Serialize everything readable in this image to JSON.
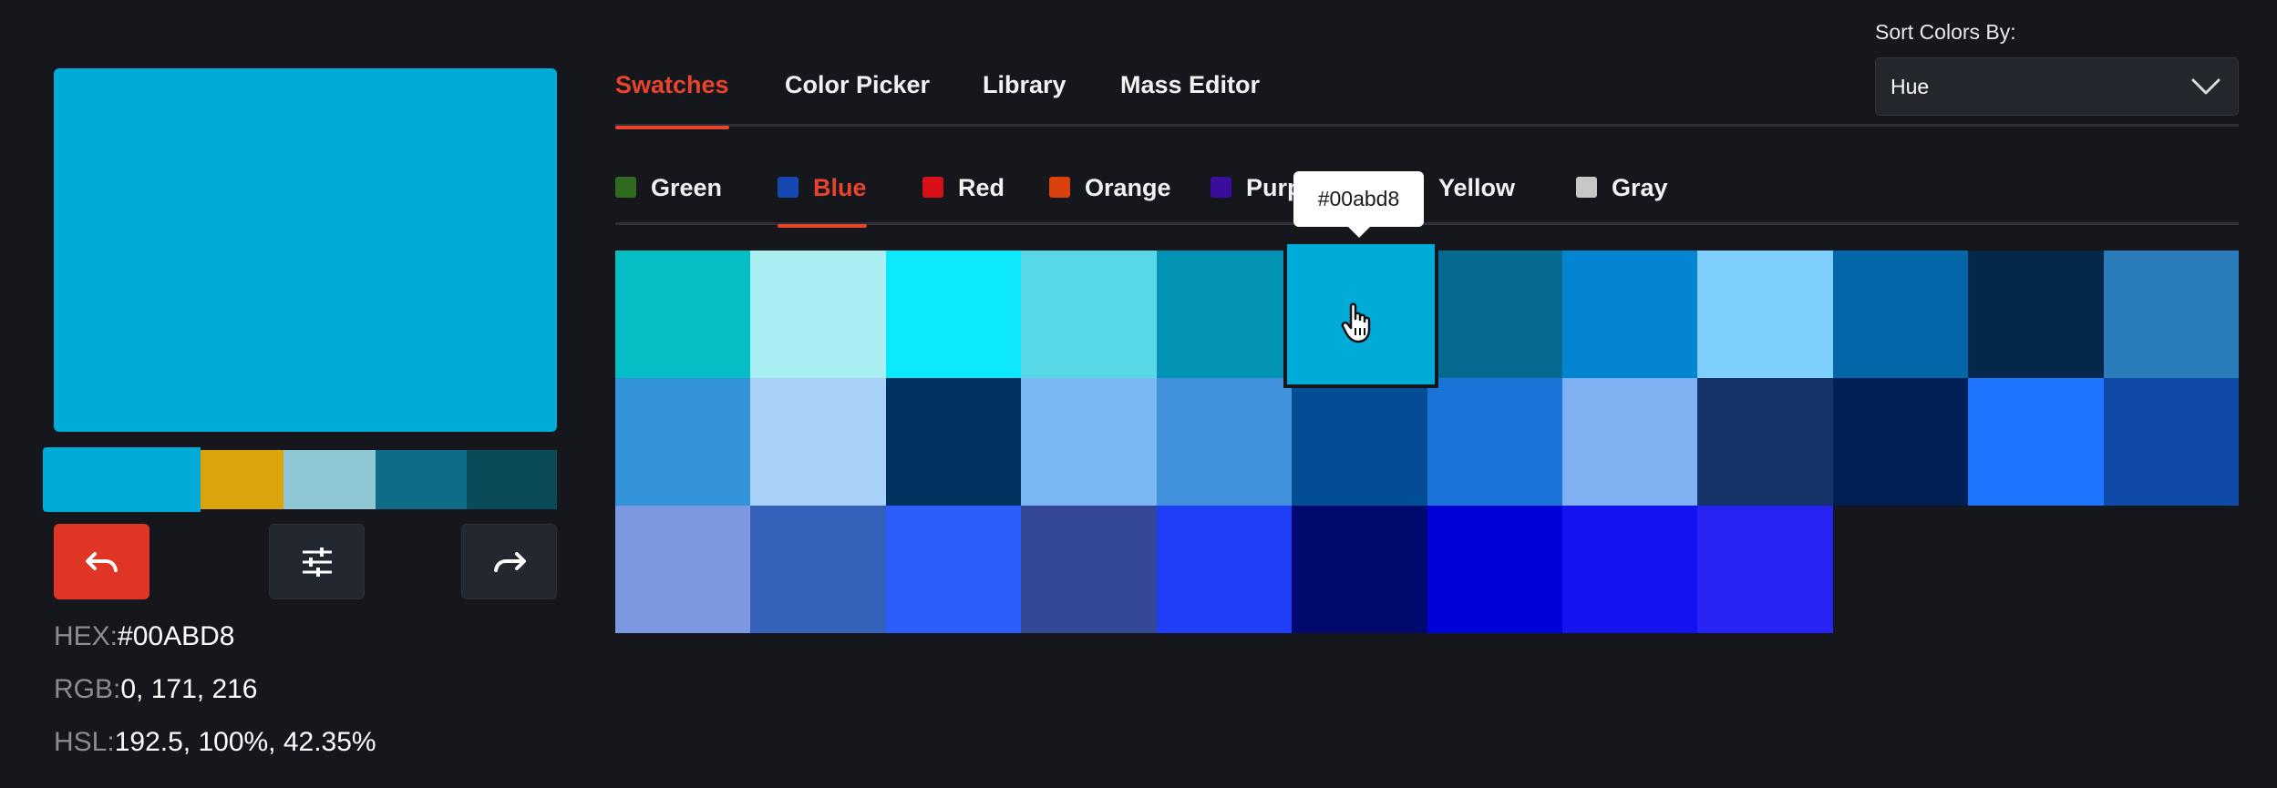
{
  "current_color": {
    "hex_value": "#00ABD8",
    "rgb_value": "0, 171, 216",
    "hsl_value": "192.5, 100%, 42.35%",
    "hex_label": "HEX:",
    "rgb_label": "RGB:",
    "hsl_label": "HSL:",
    "swatch_color": "#00abd8"
  },
  "history": [
    "#00abd8",
    "#dba40b",
    "#8ec6d3",
    "#0e6b88",
    "#0b4a58"
  ],
  "buttons": {
    "undo_icon": "undo-icon",
    "adjust_icon": "sliders-icon",
    "redo_icon": "redo-icon",
    "undo_color": "#e03424"
  },
  "tabs": [
    "Swatches",
    "Color Picker",
    "Library",
    "Mass Editor"
  ],
  "active_tab": "Swatches",
  "sort": {
    "label": "Sort Colors By:",
    "value": "Hue"
  },
  "families": [
    {
      "label": "Green",
      "color": "#2f6a1f"
    },
    {
      "label": "Blue",
      "color": "#1548b0"
    },
    {
      "label": "Red",
      "color": "#d80f14"
    },
    {
      "label": "Orange",
      "color": "#d9400c"
    },
    {
      "label": "Purple",
      "color": "#3a0d9c"
    },
    {
      "label": "Yellow",
      "color": "#f2d21a"
    },
    {
      "label": "Gray",
      "color": "#c7c7c7"
    }
  ],
  "active_family": "Blue",
  "swatches": [
    [
      "#03bec4",
      "#a9eef0",
      "#0ce9fc",
      "#58d8e6",
      "#0293b5",
      "#00abd8",
      "#056a92",
      "#0385d2",
      "#7ecffd",
      "#0266a8",
      "#04284a",
      "#2a7dba"
    ],
    [
      "#3394dc",
      "#a8d2f8",
      "#01315f",
      "#79b8f2",
      "#4291dc",
      "#024d94",
      "#1b74d8",
      "#7eb0f2",
      "#153366",
      "#011f52",
      "#1d74ff",
      "#0f4aa8"
    ],
    [
      "#7b98e1",
      "#3561bb",
      "#2b5efd",
      "#344896",
      "#1f3ef6",
      "#01096e",
      "#0000d8",
      "#1412ef",
      "#2723f2"
    ]
  ],
  "selected_swatch": "#00abd8",
  "tooltip": "#00abd8",
  "accent_color": "#e8432d"
}
